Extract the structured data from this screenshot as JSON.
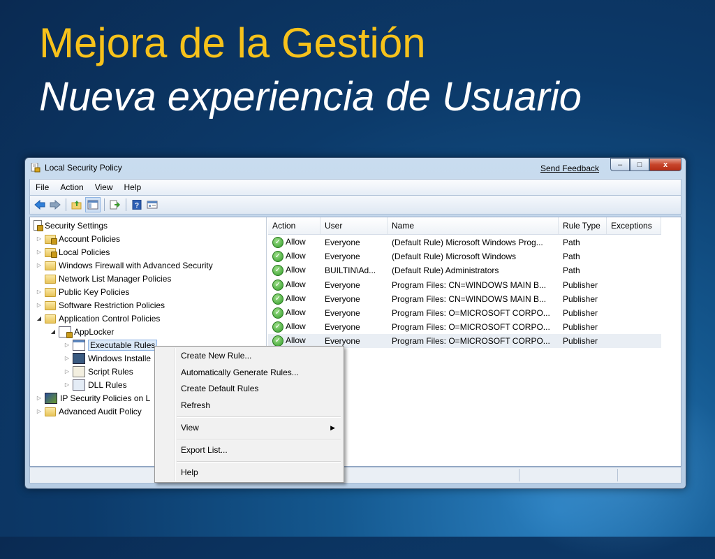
{
  "slide": {
    "title": "Mejora de la Gestión",
    "subtitle": "Nueva experiencia de Usuario"
  },
  "window": {
    "title": "Local Security Policy",
    "feedback_link": "Send Feedback",
    "controls": {
      "minimize": "‒",
      "maximize": "□",
      "close": "x"
    }
  },
  "menubar": {
    "items": [
      "File",
      "Action",
      "View",
      "Help"
    ]
  },
  "toolbar": {
    "icons": [
      "back-icon",
      "forward-icon",
      "up-folder-icon",
      "show-hide-tree-icon",
      "export-list-icon",
      "help-icon",
      "properties-icon"
    ]
  },
  "tree": {
    "items": [
      {
        "label": "Security Settings"
      },
      {
        "label": "Account Policies"
      },
      {
        "label": "Local Policies"
      },
      {
        "label": "Windows Firewall with Advanced Security"
      },
      {
        "label": "Network List Manager Policies"
      },
      {
        "label": "Public Key Policies"
      },
      {
        "label": "Software Restriction Policies"
      },
      {
        "label": "Application Control Policies"
      },
      {
        "label": "AppLocker"
      },
      {
        "label": "Executable Rules"
      },
      {
        "label": "Windows Installe"
      },
      {
        "label": "Script Rules"
      },
      {
        "label": "DLL Rules"
      },
      {
        "label": "IP Security Policies on L"
      },
      {
        "label": "Advanced Audit Policy"
      }
    ]
  },
  "list": {
    "columns": [
      "Action",
      "User",
      "Name",
      "Rule Type",
      "Exceptions"
    ],
    "rows": [
      {
        "action": "Allow",
        "user": "Everyone",
        "name": "(Default Rule) Microsoft Windows Prog...",
        "type": "Path",
        "exceptions": ""
      },
      {
        "action": "Allow",
        "user": "Everyone",
        "name": "(Default Rule) Microsoft Windows",
        "type": "Path",
        "exceptions": ""
      },
      {
        "action": "Allow",
        "user": "BUILTIN\\Ad...",
        "name": "(Default Rule) Administrators",
        "type": "Path",
        "exceptions": ""
      },
      {
        "action": "Allow",
        "user": "Everyone",
        "name": "Program Files: CN=WINDOWS MAIN B...",
        "type": "Publisher",
        "exceptions": ""
      },
      {
        "action": "Allow",
        "user": "Everyone",
        "name": "Program Files: CN=WINDOWS MAIN B...",
        "type": "Publisher",
        "exceptions": ""
      },
      {
        "action": "Allow",
        "user": "Everyone",
        "name": "Program Files: O=MICROSOFT CORPO...",
        "type": "Publisher",
        "exceptions": ""
      },
      {
        "action": "Allow",
        "user": "Everyone",
        "name": "Program Files: O=MICROSOFT CORPO...",
        "type": "Publisher",
        "exceptions": ""
      },
      {
        "action": "Allow",
        "user": "Everyone",
        "name": "Program Files: O=MICROSOFT CORPO...",
        "type": "Publisher",
        "exceptions": ""
      }
    ]
  },
  "context_menu": {
    "items": [
      "Create New Rule...",
      "Automatically Generate Rules...",
      "Create Default Rules",
      "Refresh",
      "View",
      "Export List...",
      "Help"
    ]
  },
  "colors": {
    "title_yellow": "#f7c21b",
    "allow_green": "#2f9b27",
    "selection_blue": "#dbe9f8"
  }
}
